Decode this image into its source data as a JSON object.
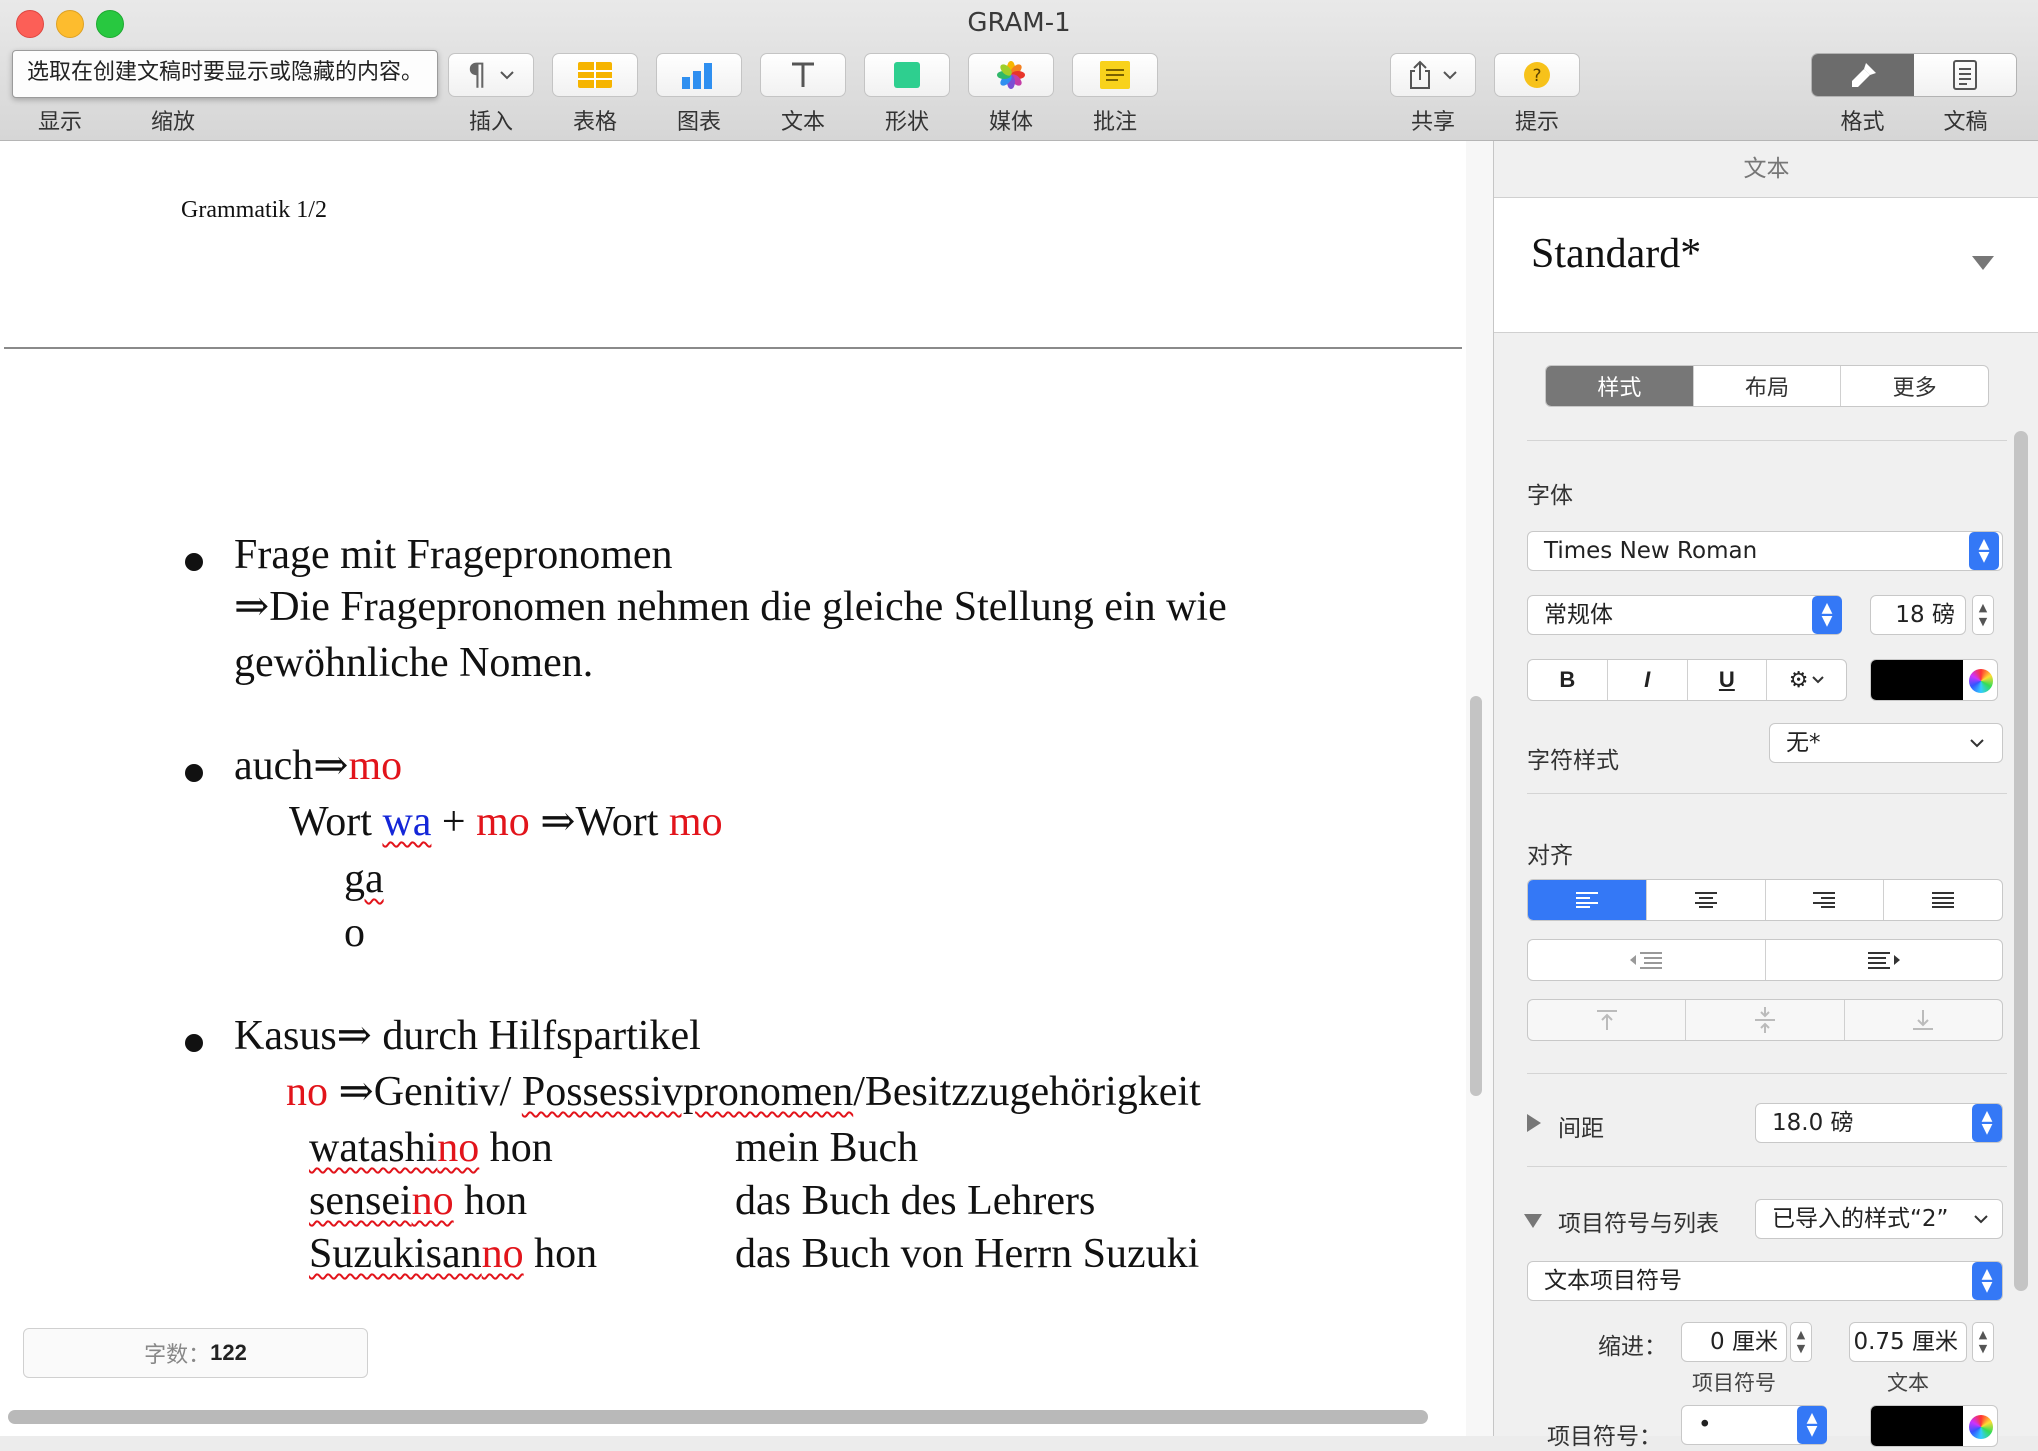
{
  "window": {
    "title": "GRAM-1"
  },
  "toolbar": {
    "tooltip": "选取在创建文稿时要显示或隐藏的内容。",
    "labels": {
      "view": "显示",
      "zoom": "缩放",
      "insert": "插入",
      "table": "表格",
      "chart": "图表",
      "text": "文本",
      "shape": "形状",
      "media": "媒体",
      "comment": "批注",
      "share": "共享",
      "tips": "提示",
      "format": "格式",
      "document": "文稿"
    }
  },
  "document": {
    "header": "Grammatik 1/2",
    "b1_title": "Frage mit Fragepronomen",
    "b1_line2": "⇒Die Fragepronomen nehmen die gleiche Stellung ein wie",
    "b1_line3": "gewöhnliche Nomen.",
    "b2_auch": "auch⇒",
    "b2_mo": "mo",
    "b2_wort1": "Wort ",
    "b2_wa": "wa",
    "b2_plus": " + ",
    "b2_mo2": "mo",
    "b2_arrow": " ⇒Wort ",
    "b2_mo3": "mo",
    "b2_ga": "ga",
    "b2_o": "o",
    "b3_title": "Kasus⇒ durch Hilfspartikel",
    "b3_no": "no",
    "b3_gen": " ⇒Genitiv/ ",
    "b3_poss": "Possessivpronomen",
    "b3_besitz": "/Besitzzugehörigkeit",
    "examples": [
      {
        "stem": "watashi",
        "particle": "no",
        "noun": " hon",
        "translation": "mein Buch"
      },
      {
        "stem": "sensei",
        "particle": "no",
        "noun": " hon",
        "translation": "das Buch des Lehrers"
      },
      {
        "stem": "Suzukisan",
        "particle": "no",
        "noun": " hon",
        "translation": "das Buch von Herrn Suzuki"
      }
    ],
    "word_count_label": "字数：",
    "word_count": "122"
  },
  "sidebar": {
    "header": "文本",
    "style_name": "Standard*",
    "tabs": [
      "样式",
      "布局",
      "更多"
    ],
    "font_label": "字体",
    "font_family": "Times New Roman",
    "font_typeface": "常规体",
    "font_size": "18 磅",
    "bold": "B",
    "italic": "I",
    "underline": "U",
    "char_style_label": "字符样式",
    "char_style_value": "无*",
    "alignment_label": "对齐",
    "spacing_label": "间距",
    "spacing_value": "18.0 磅",
    "bullets_label": "项目符号与列表",
    "bullets_style": "已导入的样式“2”",
    "bullet_type": "文本项目符号",
    "indent_label": "缩进：",
    "indent_bullet_value": "0 厘米",
    "indent_text_value": "0.75 厘米",
    "indent_bullet_caption": "项目符号",
    "indent_text_caption": "文本",
    "bullet_symbol_label": "项目符号：",
    "bullet_symbol_value": "•",
    "accent_color": "#3478f6"
  }
}
